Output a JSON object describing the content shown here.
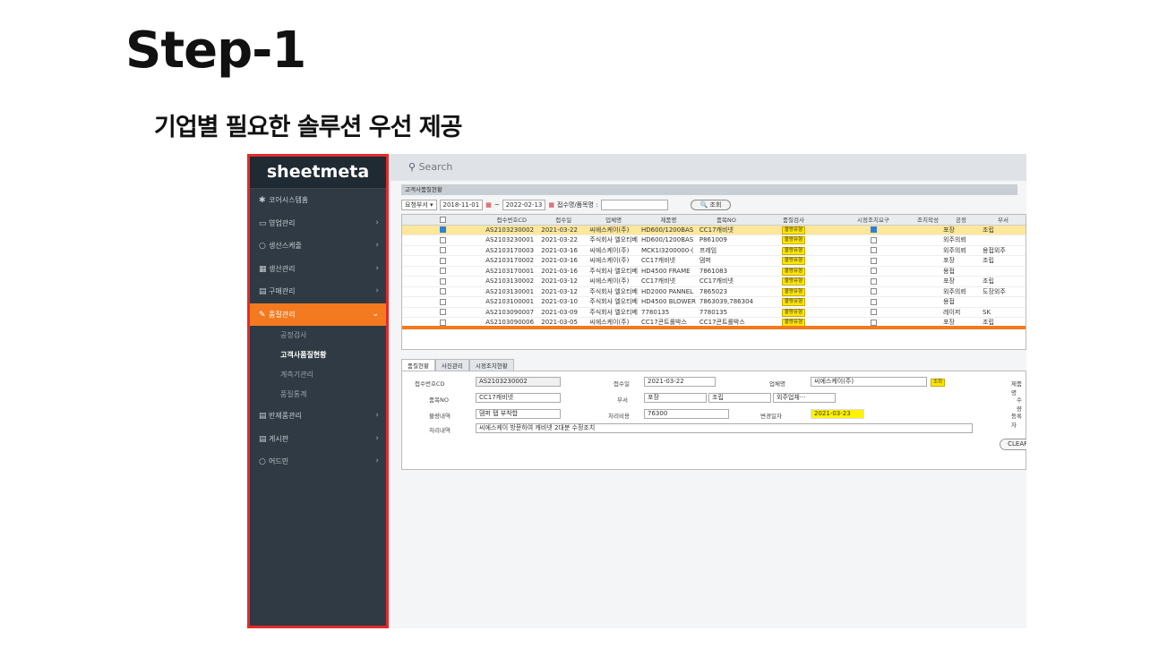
{
  "slide": {
    "title": "Step-1",
    "subtitle": "기업별 필요한 솔루션 우선 제공"
  },
  "app": {
    "logo": "sheetmeta",
    "search_placeholder": "Search",
    "nav": [
      {
        "icon": "home-icon",
        "glyph": "✱",
        "label": "코어시스템홈"
      },
      {
        "icon": "monitor-icon",
        "glyph": "▭",
        "label": "영업관리"
      },
      {
        "icon": "circle-icon",
        "glyph": "○",
        "label": "생산스케줄"
      },
      {
        "icon": "grid-icon",
        "glyph": "▦",
        "label": "생산관리"
      },
      {
        "icon": "table-icon",
        "glyph": "▤",
        "label": "구매관리"
      },
      {
        "icon": "edit-icon",
        "glyph": "✎",
        "label": "품질관리"
      }
    ],
    "subnav": [
      "공정검사",
      "고객사품질현황",
      "계측기관리",
      "품질통계"
    ],
    "nav2": [
      {
        "icon": "table-icon",
        "glyph": "▤",
        "label": "반제품관리"
      },
      {
        "icon": "table-icon",
        "glyph": "▤",
        "label": "게시판"
      },
      {
        "icon": "circle-icon",
        "glyph": "○",
        "label": "어드민"
      }
    ],
    "panel_title": "고객사품질현황",
    "filter": {
      "dept": "요청부서 ▾",
      "from": "2018-11-01",
      "to": "2022-02-13",
      "search_label": "접수명/품목명 :",
      "btn": "🔍 조회"
    },
    "columns": [
      "접수번호CD",
      "접수일",
      "업체명",
      "제품명",
      "품목NO",
      "품질검사",
      "시정조치요구",
      "조치작성",
      "공정",
      "부서"
    ],
    "rows": [
      [
        "AS2103230002",
        "2021-03-22",
        "씨에스케이(주)",
        "HD600/1200BAS",
        "CC17캐비넷",
        "불량유형",
        "on",
        "",
        "포장",
        "조립"
      ],
      [
        "AS2103230001",
        "2021-03-22",
        "주식회사 엘오티베",
        "HD600/1200BAS",
        "P861009",
        "불량유형",
        "",
        "",
        "외주의뢰",
        ""
      ],
      [
        "AS2103170003",
        "2021-03-16",
        "씨에스케이(주)",
        "MCK1I3200000-(",
        "프레임",
        "불량유형",
        "",
        "",
        "외주의뢰",
        "용접외주"
      ],
      [
        "AS2103170002",
        "2021-03-16",
        "씨에스케이(주)",
        "CC17캐비넷",
        "댐퍼",
        "불량유형",
        "",
        "",
        "포장",
        "조립"
      ],
      [
        "AS2103170001",
        "2021-03-16",
        "주식회사 엘오티베",
        "HD4500 FRAME",
        "7861083",
        "불량유형",
        "",
        "",
        "용접",
        ""
      ],
      [
        "AS2103130002",
        "2021-03-12",
        "씨에스케이(주)",
        "CC17캐비넷",
        "CC17캐비넷",
        "불량유형",
        "",
        "",
        "포장",
        "조립"
      ],
      [
        "AS2103130001",
        "2021-03-12",
        "주식회사 엘오티베",
        "HD2000 PANNEL",
        "7865023",
        "불량유형",
        "",
        "",
        "외주의뢰",
        "도장외주"
      ],
      [
        "AS2103100001",
        "2021-03-10",
        "주식회사 엘오티베",
        "HD4500 BLOWER",
        "7863039,786304",
        "불량유형",
        "",
        "",
        "용접",
        ""
      ],
      [
        "AS2103090007",
        "2021-03-09",
        "주식회사 엘오티베",
        "7780135",
        "7780135",
        "불량유형",
        "",
        "",
        "레이저",
        "SK"
      ],
      [
        "AS2103090006",
        "2021-03-05",
        "씨에스케이(주)",
        "CC17콘트롤박스",
        "CC17콘트롤박스",
        "불량유형",
        "",
        "",
        "포장",
        "조립"
      ]
    ],
    "tabs": [
      "품질현황",
      "사진관리",
      "시정조치현황"
    ],
    "form": {
      "l_no": "접수번호CD",
      "v_no": "AS2103230002",
      "l_date": "접수일",
      "v_date": "2021-03-22",
      "l_company": "업체명",
      "v_company": "씨에스케이(주)",
      "v_company_btn": "조회",
      "l_product": "제품명",
      "l_item": "품목NO",
      "v_item": "CC17캐비넷",
      "l_dept": "부서",
      "v_dept1": "포장",
      "v_dept2": "조립",
      "v_dept3": "외주업체···",
      "l_qty": "수량",
      "l_defect": "불량내역",
      "v_defect": "댐퍼 탭 부착합",
      "l_cost": "처리비용",
      "v_cost": "76300",
      "l_change": "변경일자",
      "v_change": "2021-03-23",
      "l_reg": "등록자",
      "l_process": "처리내역",
      "v_process": "씨에스케이 방문하여 캐비넷 2대분 수정조치",
      "clear": "CLEAR"
    }
  }
}
